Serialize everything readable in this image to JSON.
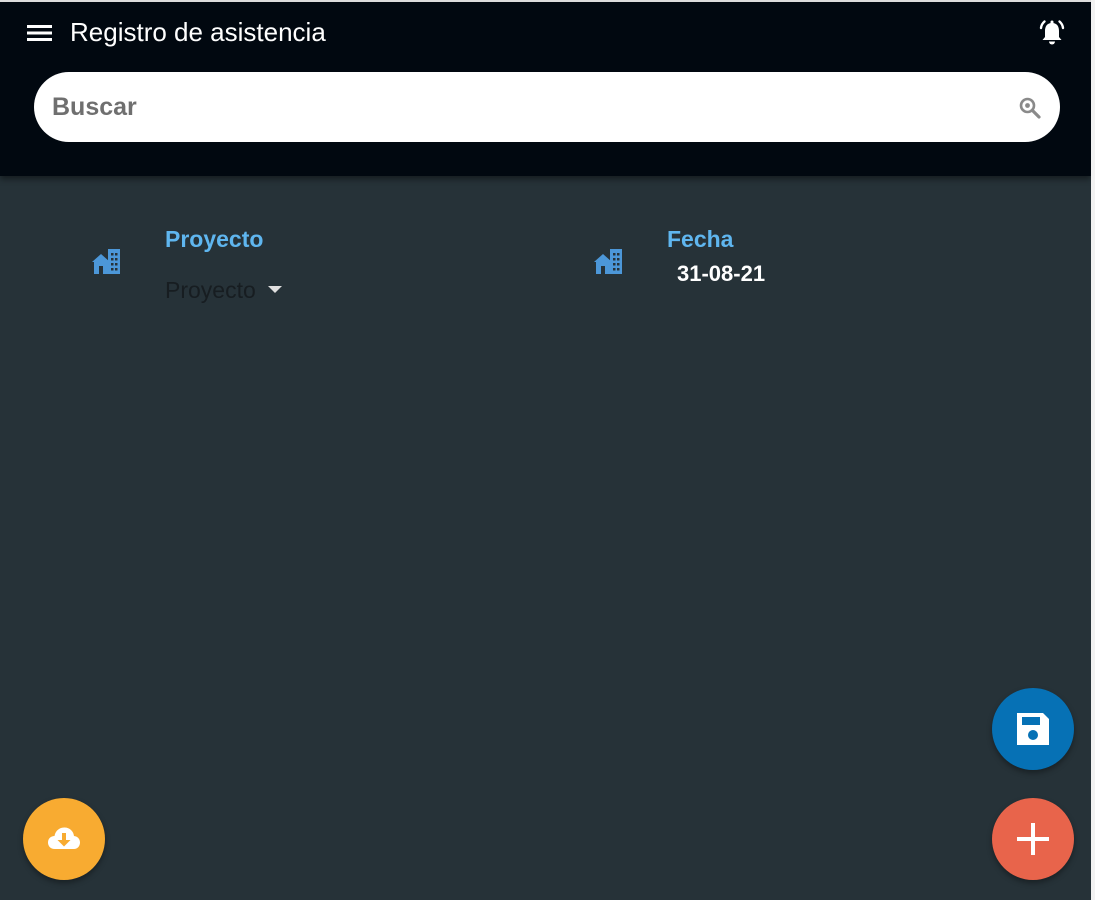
{
  "header": {
    "menu_icon": "menu-icon",
    "title": "Registro de asistencia",
    "alarm_icon": "alarm-bell-icon"
  },
  "search": {
    "placeholder": "Buscar",
    "value": "",
    "icon": "search-icon"
  },
  "form": {
    "project": {
      "icon": "building-icon",
      "label": "Proyecto",
      "selected_value": "Proyecto"
    },
    "date": {
      "icon": "building-icon",
      "label": "Fecha",
      "value": "31-08-21"
    }
  },
  "actions": {
    "save_icon": "save-icon",
    "add_icon": "add-icon",
    "download_icon": "cloud-download-icon"
  },
  "colors": {
    "toolbar": "#010810",
    "background": "#263238",
    "label": "#5fb6ef",
    "save_fab": "#0671b5",
    "add_fab": "#e8644b",
    "download_fab": "#f8ab31"
  }
}
